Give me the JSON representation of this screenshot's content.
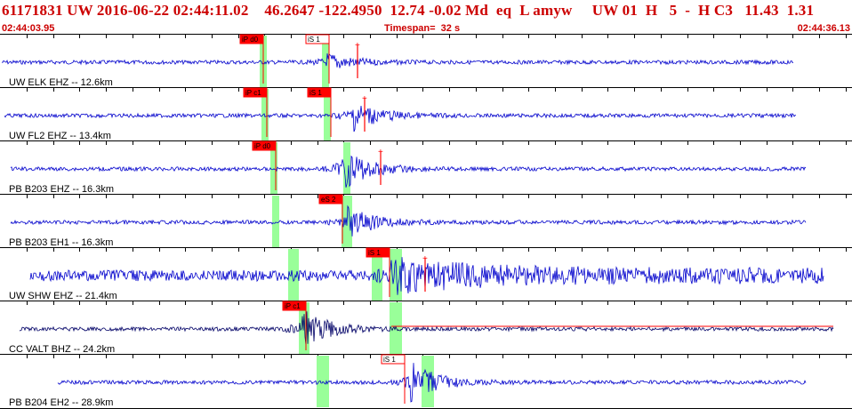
{
  "header": {
    "title": "61171831 UW 2016-06-22 02:44:11.02    46.2647 -122.4950  12.74 -0.02 Md  eq  L amyw     UW 01  H   5  -  H C3   11.43  1.31",
    "start_time": "02:44:03.95",
    "timespan": "Timespan=  32 s",
    "end_time": "02:44:36.13"
  },
  "colors": {
    "header_text": "#cc0000",
    "trace": "#0000cc",
    "trace_dark": "#000066",
    "pick_box": "#ff0000",
    "pick_window": "#99ff99",
    "divider": "#000000",
    "tick": "#000000"
  },
  "channels": [
    {
      "label": "UW ELK EHZ -- 12.6km",
      "color": "trace",
      "picks": [
        {
          "text": "iP d0",
          "filled": true
        },
        {
          "text": "iS 1",
          "filled": false
        }
      ]
    },
    {
      "label": "UW FL2 EHZ -- 13.4km",
      "color": "trace",
      "picks": [
        {
          "text": "iP c1",
          "filled": true
        },
        {
          "text": "iS 1",
          "filled": true
        }
      ]
    },
    {
      "label": "PB B203 EHZ -- 16.3km",
      "color": "trace",
      "picks": [
        {
          "text": "iP d0",
          "filled": true
        }
      ]
    },
    {
      "label": "PB B203 EH1 -- 16.3km",
      "color": "trace",
      "picks": [
        {
          "text": "eS 2",
          "filled": true
        }
      ]
    },
    {
      "label": "UW SHW EHZ -- 21.4km",
      "color": "trace",
      "picks": [
        {
          "text": "iS 1",
          "filled": true
        }
      ]
    },
    {
      "label": "CC VALT BHZ -- 24.2km",
      "color": "trace_dark",
      "picks": [
        {
          "text": "iP c1",
          "filled": true
        }
      ]
    },
    {
      "label": "PB B204 EH2 -- 28.9km",
      "color": "trace",
      "picks": [
        {
          "text": "iS 1",
          "filled": false
        }
      ]
    }
  ]
}
